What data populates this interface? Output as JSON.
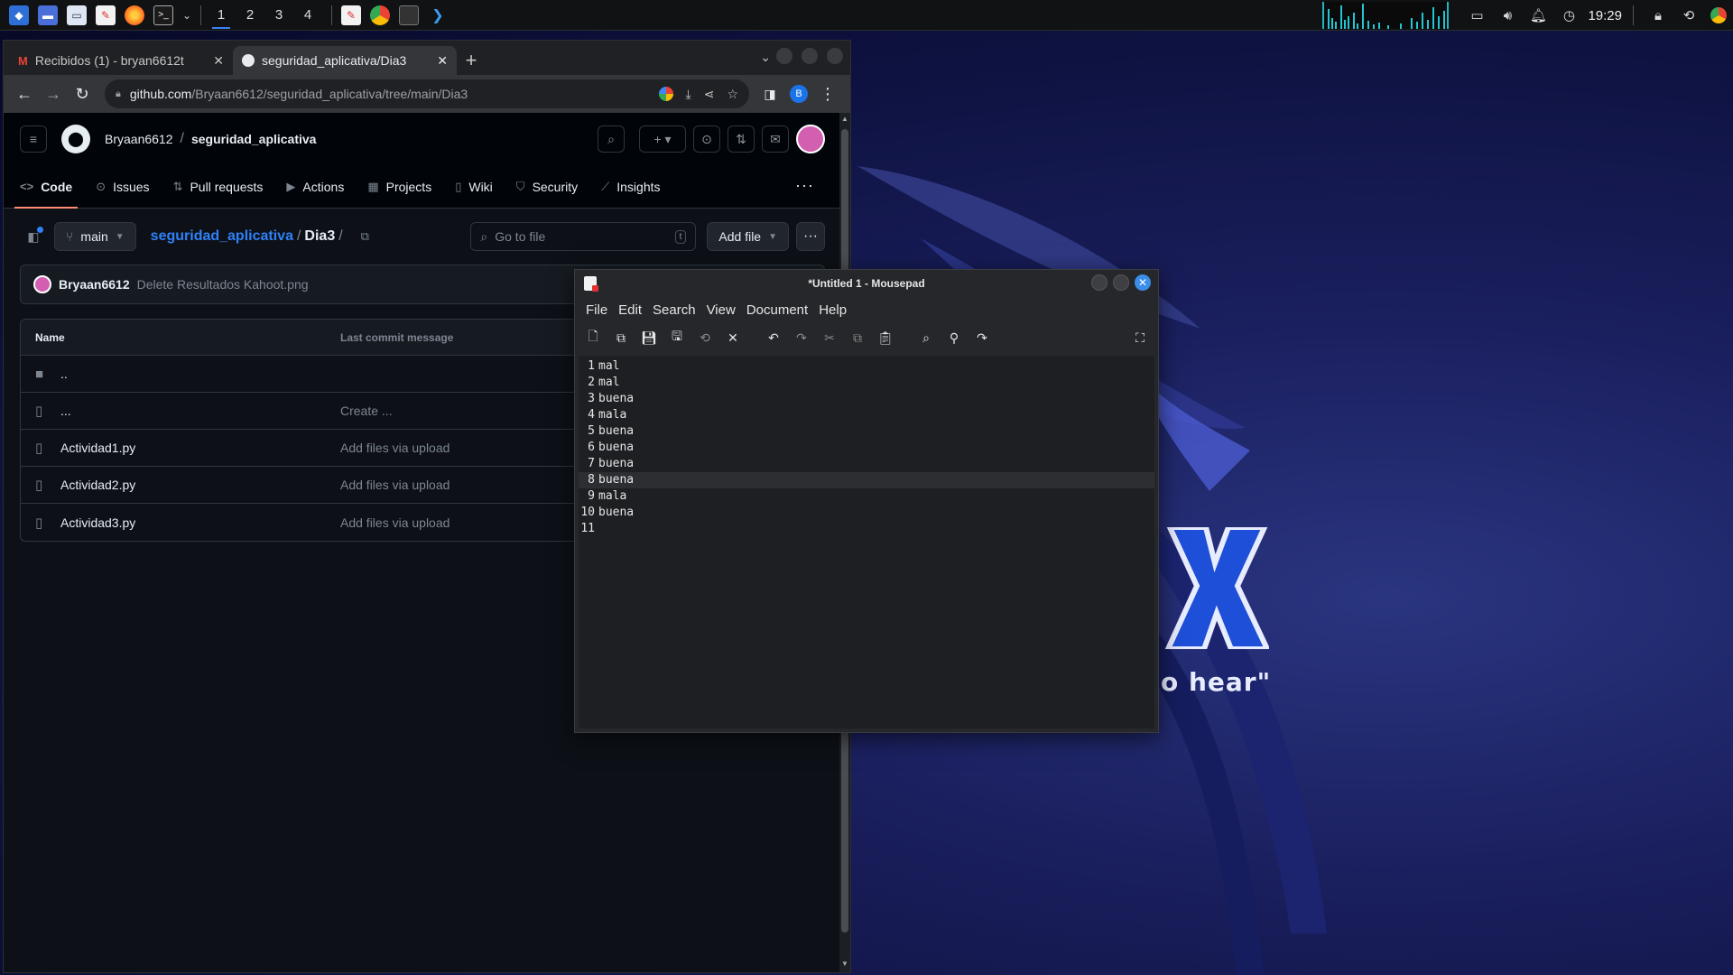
{
  "taskbar": {
    "workspaces": [
      "1",
      "2",
      "3",
      "4"
    ],
    "clock": "19:29"
  },
  "wallpaper": {
    "tagline": "o hear\""
  },
  "browser": {
    "tabs": [
      {
        "title": "Recibidos (1) - bryan6612t",
        "icon": "gmail-icon"
      },
      {
        "title": "seguridad_aplicativa/Dia3",
        "icon": "github-icon"
      }
    ],
    "url_host": "github.com",
    "url_path": "/Bryaan6612/seguridad_aplicativa/tree/main/Dia3",
    "profile_initial": "B"
  },
  "github": {
    "owner": "Bryaan6612",
    "repo": "seguridad_aplicativa",
    "nav": [
      {
        "label": "Code",
        "icon": "code-icon",
        "active": true
      },
      {
        "label": "Issues",
        "icon": "issues-icon"
      },
      {
        "label": "Pull requests",
        "icon": "pull-request-icon"
      },
      {
        "label": "Actions",
        "icon": "actions-icon"
      },
      {
        "label": "Projects",
        "icon": "projects-icon"
      },
      {
        "label": "Wiki",
        "icon": "wiki-icon"
      },
      {
        "label": "Security",
        "icon": "shield-icon"
      },
      {
        "label": "Insights",
        "icon": "graph-icon"
      }
    ],
    "branch": "main",
    "crumb_repo": "seguridad_aplicativa",
    "crumb_dir": "Dia3",
    "goto_placeholder": "Go to file",
    "goto_kbd": "t",
    "add_file": "Add file",
    "commit": {
      "author": "Bryaan6612",
      "message": "Delete Resultados Kahoot.png"
    },
    "table": {
      "col_name": "Name",
      "col_msg": "Last commit message",
      "rows": [
        {
          "name": "..",
          "msg": "",
          "type": "folder"
        },
        {
          "name": "...",
          "msg": "Create ...",
          "type": "file"
        },
        {
          "name": "Actividad1.py",
          "msg": "Add files via upload",
          "type": "file"
        },
        {
          "name": "Actividad2.py",
          "msg": "Add files via upload",
          "type": "file"
        },
        {
          "name": "Actividad3.py",
          "msg": "Add files via upload",
          "type": "file"
        }
      ]
    }
  },
  "mousepad": {
    "title": "*Untitled 1 - Mousepad",
    "menu": [
      "File",
      "Edit",
      "Search",
      "View",
      "Document",
      "Help"
    ],
    "current_line": 8,
    "lines": [
      {
        "n": "1",
        "text": "mal"
      },
      {
        "n": "2",
        "text": "mal"
      },
      {
        "n": "3",
        "text": "buena"
      },
      {
        "n": "4",
        "text": "mala"
      },
      {
        "n": "5",
        "text": "buena"
      },
      {
        "n": "6",
        "text": "buena"
      },
      {
        "n": "7",
        "text": "buena"
      },
      {
        "n": "8",
        "text": "buena"
      },
      {
        "n": "9",
        "text": "mala"
      },
      {
        "n": "10",
        "text": "buena"
      },
      {
        "n": "11",
        "text": ""
      }
    ]
  }
}
